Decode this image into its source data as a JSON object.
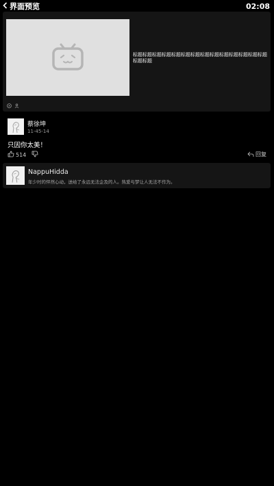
{
  "header": {
    "back_icon": "chevron-left-icon",
    "title": "界面预览",
    "clock": "02:08"
  },
  "video": {
    "thumbnail_icon": "bilibili-tv-icon",
    "title": "标题标题标题标题标题标题标题标题标题标题标题标题标题标题标题标题",
    "stats_icons": [
      "play-icon",
      "person-icon"
    ]
  },
  "comment": {
    "username": "蔡徐坤",
    "time": "11-45-14",
    "content": "只因你太美！",
    "likes": "514",
    "reply_label": "回复"
  },
  "user_card": {
    "username": "NappuHidda",
    "signature": "年少时的怦然心动，送给了永远无法企及的人。热爱与梦让人无法不作为。"
  }
}
